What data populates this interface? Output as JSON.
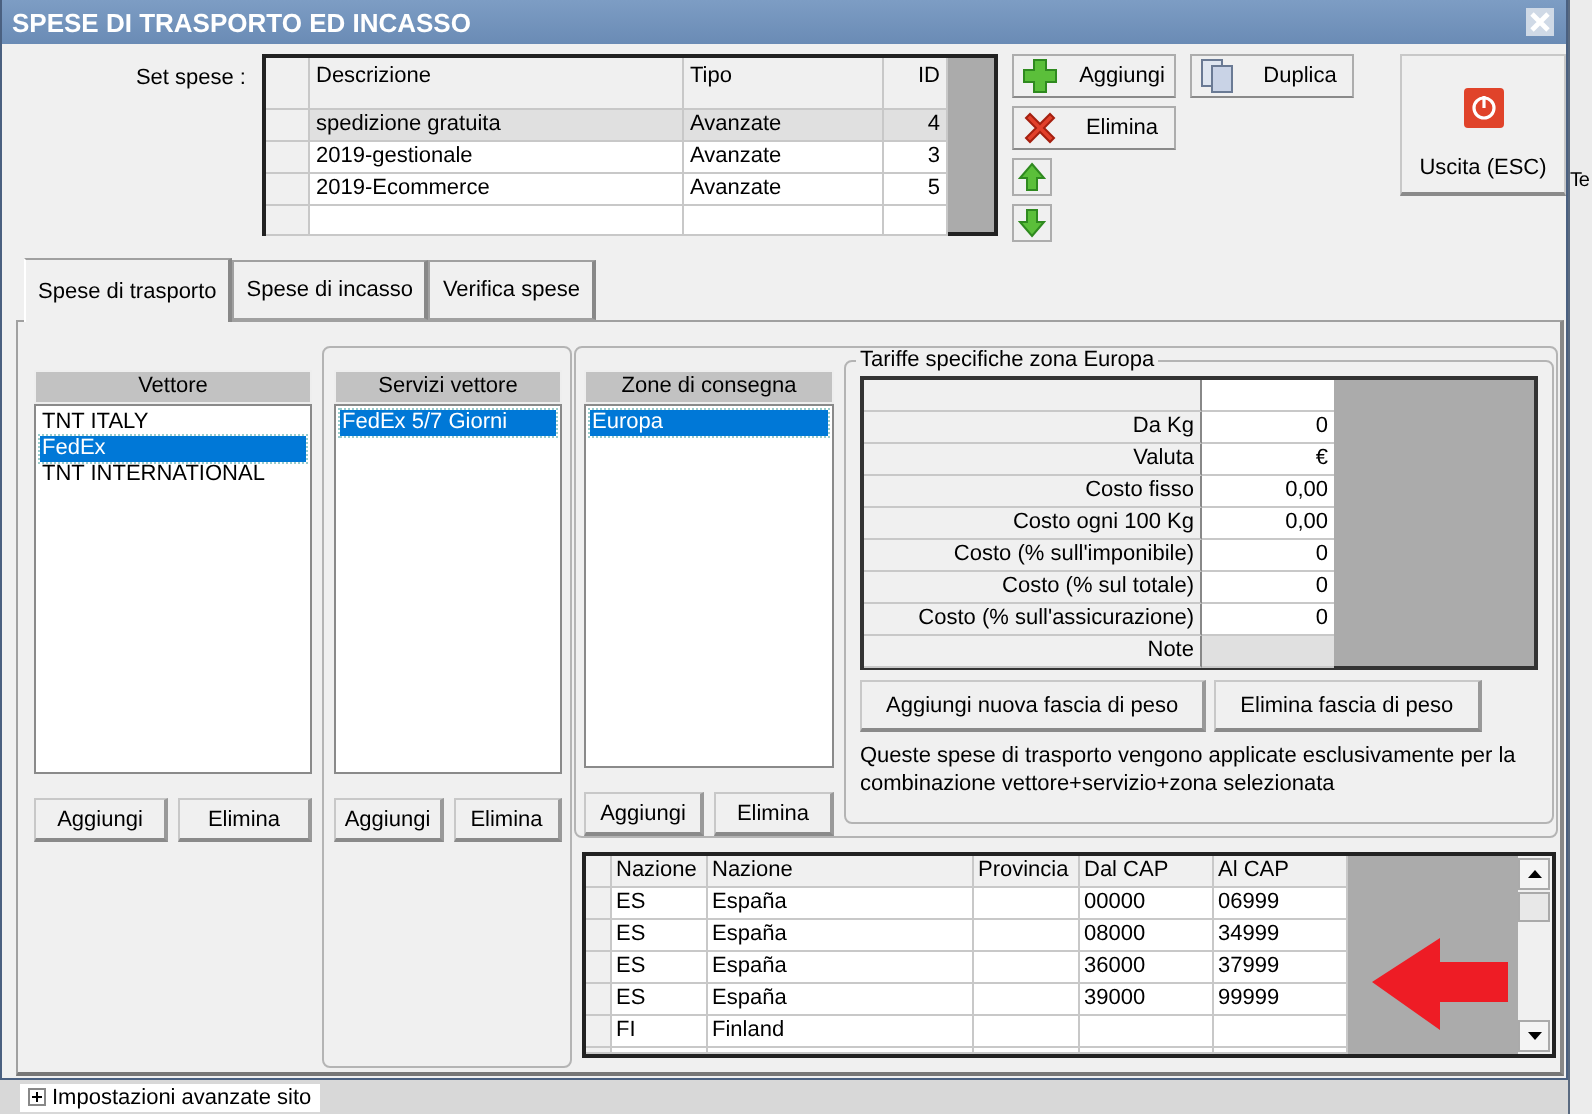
{
  "window": {
    "title": "SPESE DI TRASPORTO ED INCASSO"
  },
  "set_spese": {
    "label": "Set spese :",
    "columns": [
      "Descrizione",
      "Tipo",
      "ID"
    ],
    "rows": [
      {
        "description": "spedizione gratuita",
        "type": "Avanzate",
        "id": "4",
        "selected": true
      },
      {
        "description": "2019-gestionale",
        "type": "Avanzate",
        "id": "3",
        "selected": false
      },
      {
        "description": "2019-Ecommerce",
        "type": "Avanzate",
        "id": "5",
        "selected": false
      }
    ]
  },
  "set_buttons": [
    {
      "kind": "add",
      "label": "Aggiungi"
    },
    {
      "kind": "delete",
      "label": "Elimina"
    },
    {
      "kind": "up"
    },
    {
      "kind": "down"
    }
  ],
  "duplicate_button": {
    "label": "Duplica"
  },
  "exit_button": {
    "label": "Uscita (ESC)"
  },
  "tabs": [
    {
      "label": "Spese di trasporto",
      "selected": true
    },
    {
      "label": "Spese di incasso",
      "selected": false
    },
    {
      "label": "Verifica spese",
      "selected": false
    }
  ],
  "carriers": {
    "title": "Vettore",
    "items": [
      {
        "label": "TNT ITALY",
        "selected": false
      },
      {
        "label": "FedEx",
        "selected": true
      },
      {
        "label": "TNT INTERNATIONAL",
        "selected": false
      }
    ],
    "buttons": [
      "Aggiungi",
      "Elimina"
    ]
  },
  "services": {
    "title": "Servizi vettore",
    "items": [
      {
        "label": "FedEx 5/7 Giorni",
        "selected": true
      }
    ],
    "buttons": [
      "Aggiungi",
      "Elimina"
    ]
  },
  "zones": {
    "title": "Zone di consegna",
    "items": [
      {
        "label": "Europa",
        "selected": true
      }
    ],
    "buttons": [
      "Aggiungi",
      "Elimina"
    ]
  },
  "rates": {
    "title": "Tariffe specifiche zona Europa",
    "rows": [
      {
        "label": "Da Kg",
        "value": "0"
      },
      {
        "label": "Valuta",
        "value": "€"
      },
      {
        "label": "Costo fisso",
        "value": "0,00"
      },
      {
        "label": "Costo ogni 100 Kg",
        "value": "0,00"
      },
      {
        "label": "Costo (% sull'imponibile)",
        "value": "0"
      },
      {
        "label": "Costo (% sul totale)",
        "value": "0"
      },
      {
        "label": "Costo (% sull'assicurazione)",
        "value": "0"
      },
      {
        "label": "Note"
      }
    ],
    "buttons": [
      "Aggiungi nuova fascia di peso",
      "Elimina fascia di peso"
    ],
    "note": "Queste spese di trasporto vengono applicate esclusivamente per la combinazione vettore+servizio+zona selezionata"
  },
  "zone_grid": {
    "columns": [
      "Nazione",
      "Nazione",
      "Provincia",
      "Dal CAP",
      "Al CAP"
    ],
    "rows": [
      {
        "code": "ES",
        "country": "España",
        "from": "00000",
        "to": "06999"
      },
      {
        "code": "ES",
        "country": "España",
        "from": "08000",
        "to": "34999"
      },
      {
        "code": "ES",
        "country": "España",
        "from": "36000",
        "to": "37999"
      },
      {
        "code": "ES",
        "country": "España",
        "from": "39000",
        "to": "99999"
      },
      {
        "code": "FI",
        "country": "Finland"
      }
    ]
  },
  "background": {
    "side_text": "Te",
    "tree_item": "Impostazioni avanzate sito"
  }
}
